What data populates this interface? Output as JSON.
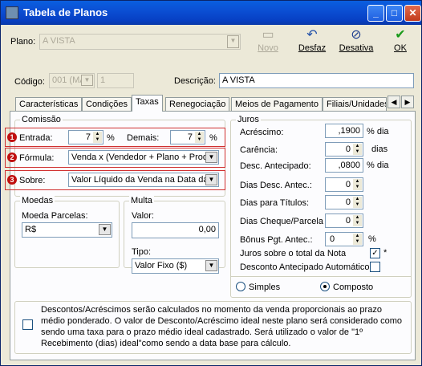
{
  "window": {
    "title": "Tabela de Planos"
  },
  "header": {
    "plano_label": "Plano:",
    "plano_value": "A VISTA",
    "codigo_label": "Código:",
    "codigo_value": "001 (MA",
    "codigo_num": "1",
    "descricao_label": "Descrição:",
    "descricao_value": "A VISTA"
  },
  "toolbar": {
    "novo": "Novo",
    "desfaz": "Desfaz",
    "desativa": "Desativa",
    "ok": "OK"
  },
  "tabs": [
    "Características",
    "Condições",
    "Taxas",
    "Renegociação",
    "Meios de Pagamento",
    "Filiais/Unidades"
  ],
  "comissao": {
    "title": "Comissão",
    "entrada_label": "Entrada:",
    "entrada_value": "7",
    "pct": "%",
    "demais_label": "Demais:",
    "demais_value": "7",
    "formula_label": "Fórmula:",
    "formula_value": "Venda x (Vendedor + Plano + Produ",
    "sobre_label": "Sobre:",
    "sobre_value": "Valor Líquido da Venda na Data da",
    "badges": [
      "1",
      "2",
      "3"
    ]
  },
  "moedas": {
    "title": "Moedas",
    "parcelas_label": "Moeda Parcelas:",
    "parcelas_value": "R$"
  },
  "multa": {
    "title": "Multa",
    "valor_label": "Valor:",
    "valor_value": "0,00",
    "tipo_label": "Tipo:",
    "tipo_value": "Valor Fixo ($)"
  },
  "juros": {
    "title": "Juros",
    "acrescimo_label": "Acréscimo:",
    "acrescimo_value": ",1900",
    "acrescimo_unit": "% dia",
    "carencia_label": "Carência:",
    "carencia_value": "0",
    "carencia_unit": "dias",
    "desc_ant_label": "Desc. Antecipado:",
    "desc_ant_value": ",0800",
    "desc_ant_unit": "% dia",
    "dias_desc_label": "Dias Desc. Antec.:",
    "dias_desc_value": "0",
    "dias_titulos_label": "Dias para Títulos:",
    "dias_titulos_value": "0",
    "dias_cheque_label": "Dias Cheque/Parcela",
    "dias_cheque_value": "0",
    "bonus_label": "Bônus Pgt. Antec.:",
    "bonus_value": "0",
    "bonus_unit": "%",
    "juros_total_label": "Juros sobre o total da Nota",
    "juros_total_mark": "✓",
    "juros_total_star": "*",
    "desc_auto_label": "Desconto Antecipado Automático",
    "simples_label": "Simples",
    "composto_label": "Composto"
  },
  "footer": {
    "text": "Descontos/Acréscimos serão calculados no momento da venda proporcionais ao prazo médio ponderado. O valor de Desconto/Acréscimo ideal neste plano será considerado como sendo uma taxa para o prazo médio ideal cadastrado. Será utilizado o valor de \"1º Recebimento (dias) ideal\"como sendo a data base para cálculo."
  }
}
